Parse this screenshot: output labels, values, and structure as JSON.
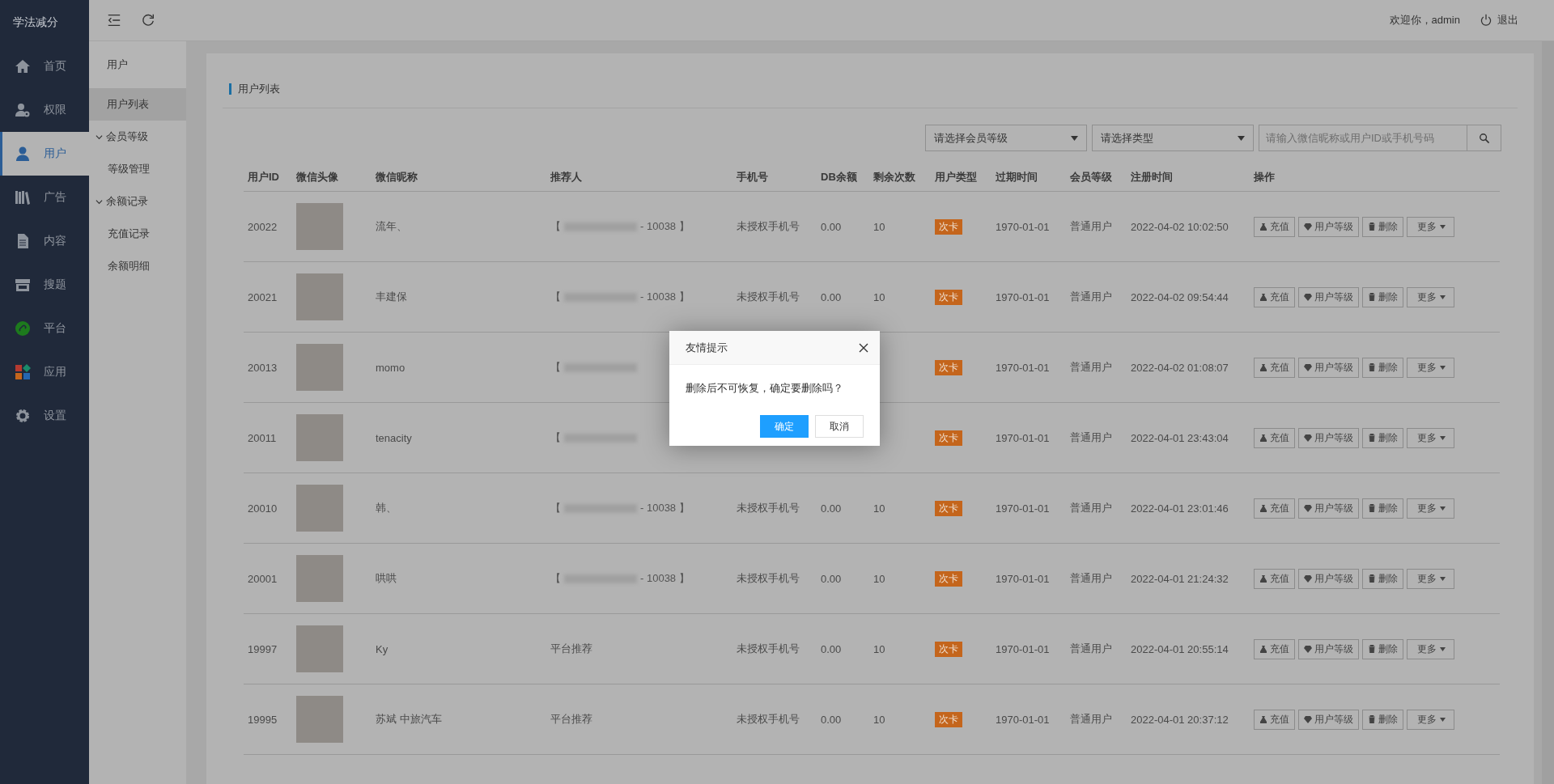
{
  "brand": "学法减分",
  "sidebar": {
    "items": [
      {
        "label": "首页",
        "selected": false
      },
      {
        "label": "权限",
        "selected": false
      },
      {
        "label": "用户",
        "selected": true
      },
      {
        "label": "广告",
        "selected": false
      },
      {
        "label": "内容",
        "selected": false
      },
      {
        "label": "搜题",
        "selected": false
      },
      {
        "label": "平台",
        "selected": false
      },
      {
        "label": "应用",
        "selected": false
      },
      {
        "label": "设置",
        "selected": false
      }
    ]
  },
  "header": {
    "welcome": "欢迎你，admin",
    "logout": "退出"
  },
  "submenu": {
    "title": "用户",
    "items": [
      {
        "label": "用户列表",
        "selected": true
      },
      {
        "label": "会员等级",
        "selected": false,
        "expanded": true,
        "children": [
          {
            "label": "等级管理",
            "selected": false
          }
        ]
      },
      {
        "label": "余额记录",
        "selected": false,
        "expanded": true,
        "children": [
          {
            "label": "充值记录",
            "selected": false
          },
          {
            "label": "余额明细",
            "selected": false
          }
        ]
      }
    ]
  },
  "card": {
    "title": "用户列表"
  },
  "filters": {
    "level_select": "请选择会员等级",
    "type_select": "请选择类型",
    "search": {
      "placeholder": "请输入微信昵称或用户ID或手机号码"
    }
  },
  "table": {
    "columns": [
      "用户ID",
      "微信头像",
      "微信昵称",
      "推荐人",
      "手机号",
      "DB余额",
      "剩余次数",
      "用户类型",
      "过期时间",
      "会员等级",
      "注册时间",
      "操作"
    ],
    "rows": [
      {
        "id": "20022",
        "nickname": "流年、",
        "referrer": {
          "kind": "masked",
          "open": "【",
          "close": "- 10038 】"
        },
        "phone": "未授权手机号",
        "balance": "0.00",
        "count": "10",
        "type": "次卡",
        "expiry": "1970-01-01",
        "level": "普通用户",
        "registered": "2022-04-02 10:02:50",
        "actions": [
          "充值",
          "用户等级",
          "删除",
          "更多"
        ]
      },
      {
        "id": "20021",
        "nickname": "丰建保",
        "referrer": {
          "kind": "masked",
          "open": "【",
          "close": "- 10038 】"
        },
        "phone": "未授权手机号",
        "balance": "0.00",
        "count": "10",
        "type": "次卡",
        "expiry": "1970-01-01",
        "level": "普通用户",
        "registered": "2022-04-02 09:54:44",
        "actions": [
          "充值",
          "用户等级",
          "删除",
          "更多"
        ]
      },
      {
        "id": "20013",
        "nickname": "momo",
        "referrer": {
          "kind": "masked",
          "open": "【"
        },
        "type": "次卡",
        "expiry": "1970-01-01",
        "level": "普通用户",
        "registered": "2022-04-02 01:08:07",
        "actions": [
          "充值",
          "用户等级",
          "删除",
          "更多"
        ]
      },
      {
        "id": "20011",
        "nickname": "tenacity",
        "referrer": {
          "kind": "masked",
          "open": "【"
        },
        "type": "次卡",
        "expiry": "1970-01-01",
        "level": "普通用户",
        "registered": "2022-04-01 23:43:04",
        "actions": [
          "充值",
          "用户等级",
          "删除",
          "更多"
        ]
      },
      {
        "id": "20010",
        "nickname": "韩、",
        "referrer": {
          "kind": "masked",
          "open": "【",
          "close": "- 10038 】"
        },
        "phone": "未授权手机号",
        "balance": "0.00",
        "count": "10",
        "type": "次卡",
        "expiry": "1970-01-01",
        "level": "普通用户",
        "registered": "2022-04-01 23:01:46",
        "actions": [
          "充值",
          "用户等级",
          "删除",
          "更多"
        ]
      },
      {
        "id": "20001",
        "nickname": "哄哄",
        "referrer": {
          "kind": "masked",
          "open": "【",
          "close": "- 10038 】"
        },
        "phone": "未授权手机号",
        "balance": "0.00",
        "count": "10",
        "type": "次卡",
        "expiry": "1970-01-01",
        "level": "普通用户",
        "registered": "2022-04-01 21:24:32",
        "actions": [
          "充值",
          "用户等级",
          "删除",
          "更多"
        ]
      },
      {
        "id": "19997",
        "nickname": "Ky",
        "referrer": {
          "kind": "plain",
          "text": "平台推荐"
        },
        "phone": "未授权手机号",
        "balance": "0.00",
        "count": "10",
        "type": "次卡",
        "expiry": "1970-01-01",
        "level": "普通用户",
        "registered": "2022-04-01 20:55:14",
        "actions": [
          "充值",
          "用户等级",
          "删除",
          "更多"
        ]
      },
      {
        "id": "19995",
        "nickname": "苏斌 中旅汽车",
        "referrer": {
          "kind": "plain",
          "text": "平台推荐"
        },
        "phone": "未授权手机号",
        "balance": "0.00",
        "count": "10",
        "type": "次卡",
        "expiry": "1970-01-01",
        "level": "普通用户",
        "registered": "2022-04-01 20:37:12",
        "actions": [
          "充值",
          "用户等级",
          "删除",
          "更多"
        ]
      }
    ]
  },
  "dialog": {
    "title": "友情提示",
    "message": "删除后不可恢复，确定要删除吗？",
    "buttons": [
      {
        "label": "确定",
        "kind": "primary"
      },
      {
        "label": "取消",
        "kind": "default"
      }
    ]
  }
}
